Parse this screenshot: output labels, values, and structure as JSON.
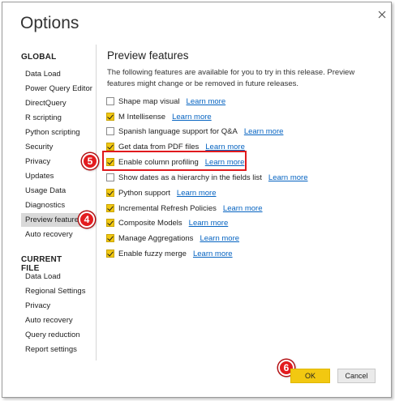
{
  "window": {
    "title": "Options",
    "close_icon": "close-icon"
  },
  "sidebar": {
    "global_header": "GLOBAL",
    "global_items": [
      {
        "label": "Data Load"
      },
      {
        "label": "Power Query Editor"
      },
      {
        "label": "DirectQuery"
      },
      {
        "label": "R scripting"
      },
      {
        "label": "Python scripting"
      },
      {
        "label": "Security"
      },
      {
        "label": "Privacy"
      },
      {
        "label": "Updates"
      },
      {
        "label": "Usage Data"
      },
      {
        "label": "Diagnostics"
      },
      {
        "label": "Preview features",
        "selected": true
      },
      {
        "label": "Auto recovery"
      }
    ],
    "current_file_header": "CURRENT FILE",
    "current_file_items": [
      {
        "label": "Data Load"
      },
      {
        "label": "Regional Settings"
      },
      {
        "label": "Privacy"
      },
      {
        "label": "Auto recovery"
      },
      {
        "label": "Query reduction"
      },
      {
        "label": "Report settings"
      }
    ]
  },
  "main": {
    "title": "Preview features",
    "description": "The following features are available for you to try in this release. Preview features might change or be removed in future releases.",
    "link_label": "Learn more",
    "features": [
      {
        "label": "Shape map visual",
        "checked": false
      },
      {
        "label": "M Intellisense",
        "checked": true
      },
      {
        "label": "Spanish language support for Q&A",
        "checked": false
      },
      {
        "label": "Get data from PDF files",
        "checked": true
      },
      {
        "label": "Enable column profiling",
        "checked": true
      },
      {
        "label": "Show dates as a hierarchy in the fields list",
        "checked": false
      },
      {
        "label": "Python support",
        "checked": true
      },
      {
        "label": "Incremental Refresh Policies",
        "checked": true
      },
      {
        "label": "Composite Models",
        "checked": true
      },
      {
        "label": "Manage Aggregations",
        "checked": true
      },
      {
        "label": "Enable fuzzy merge",
        "checked": true
      }
    ]
  },
  "footer": {
    "ok_label": "OK",
    "cancel_label": "Cancel"
  },
  "annotations": {
    "step_4": "4",
    "step_5": "5",
    "step_6": "6"
  },
  "colors": {
    "accent": "#f2c811",
    "annotation": "#e31c1f",
    "link": "#0563c1"
  }
}
